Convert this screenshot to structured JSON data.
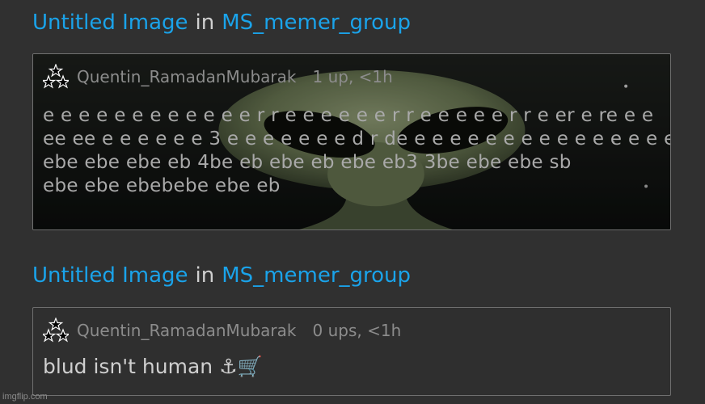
{
  "posts": [
    {
      "title": {
        "image_link": "Untitled Image",
        "in_word": "in",
        "group_link": "MS_memer_group"
      },
      "comment": {
        "username": "Quentin_RamadanMubarak",
        "meta": "1 up, <1h",
        "lines": [
          "e e e e e e e e e e e e r r e e e e e e r r e e e e e r r e er e re e e",
          "ee ee e e e e e e 3 e e e e e e e d r de e e e e e e e e e e e e e e e e",
          "ebe ebe ebe eb 4be eb ebe eb ebe eb3 3be ebe ebe sb",
          "ebe ebe ebebebe ebe eb"
        ],
        "background": "alien-image"
      }
    },
    {
      "title": {
        "image_link": "Untitled Image",
        "in_word": "in",
        "group_link": "MS_memer_group"
      },
      "comment": {
        "username": "Quentin_RamadanMubarak",
        "meta": "0 ups, <1h",
        "text": "blud isn't human ⚓🛒"
      }
    }
  ],
  "watermark": "imgflip.com",
  "colors": {
    "background": "#303030",
    "link": "#1aa3ea",
    "muted": "#8c8c8c",
    "border": "#6f6f6f"
  }
}
